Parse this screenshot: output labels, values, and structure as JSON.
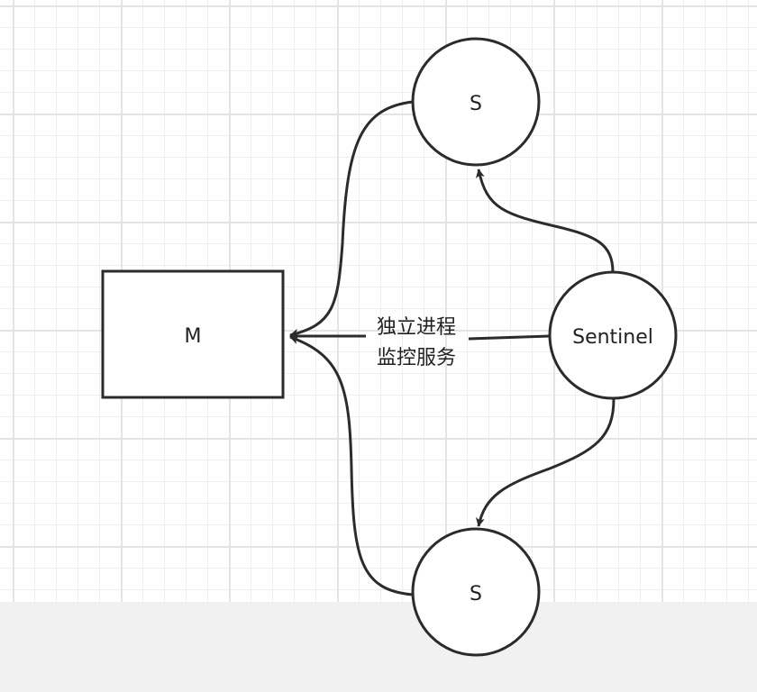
{
  "nodes": {
    "master": {
      "label": "M"
    },
    "slave_top": {
      "label": "S"
    },
    "slave_bottom": {
      "label": "S"
    },
    "sentinel": {
      "label": "Sentinel"
    }
  },
  "edges": {
    "sentinel_to_master_label_line1": "独立进程",
    "sentinel_to_master_label_line2": "监控服务"
  },
  "colors": {
    "stroke": "#2b2b2b",
    "canvas": "#ffffff",
    "grid": "#e4e4e4",
    "footer": "#f1f1f1"
  }
}
